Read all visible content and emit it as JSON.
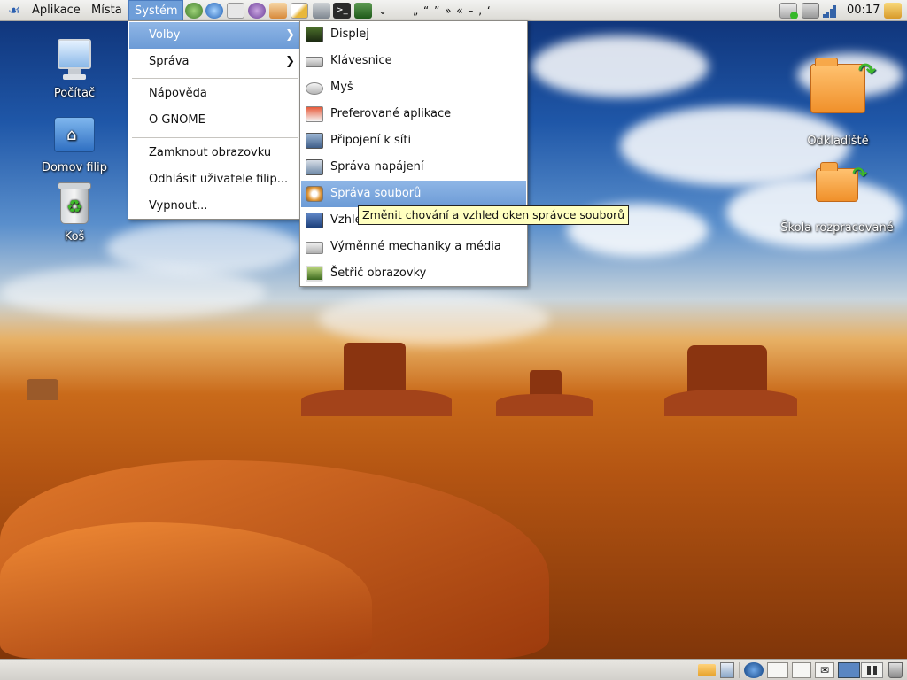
{
  "top_panel": {
    "menus": [
      "Aplikace",
      "Místa",
      "Systém"
    ],
    "punct_chars": "„  “  ”  »  «  –  ,  ‘",
    "clock": "00:17"
  },
  "desktop": {
    "left_icons": [
      {
        "label": "Počítač",
        "icon": "computer-icon"
      },
      {
        "label": "Domov filip",
        "icon": "home-folder-icon"
      },
      {
        "label": "Koš",
        "icon": "trash-icon"
      }
    ],
    "right_icons": [
      {
        "label": "Odkladiště",
        "icon": "folder-link-icon"
      },
      {
        "label": "Škola rozpracované",
        "icon": "folder-link-icon"
      }
    ]
  },
  "system_menu": {
    "items": [
      "Volby",
      "Správa",
      "Nápověda",
      "O GNOME",
      "Zamknout obrazovku",
      "Odhlásit uživatele filip...",
      "Vypnout..."
    ]
  },
  "volby_submenu": {
    "items": [
      {
        "label": "Displej",
        "icon": "display-icon"
      },
      {
        "label": "Klávesnice",
        "icon": "keyboard-icon"
      },
      {
        "label": "Myš",
        "icon": "mouse-icon"
      },
      {
        "label": "Preferované aplikace",
        "icon": "preferred-apps-icon"
      },
      {
        "label": "Připojení k síti",
        "icon": "network-icon"
      },
      {
        "label": "Správa napájení",
        "icon": "power-icon"
      },
      {
        "label": "Správa souborů",
        "icon": "file-manager-icon"
      },
      {
        "label": "Vzhled",
        "icon": "appearance-icon"
      },
      {
        "label": "Výměnné mechaniky a média",
        "icon": "removable-drive-icon"
      },
      {
        "label": "Šetřič obrazovky",
        "icon": "screensaver-icon"
      }
    ]
  },
  "tooltip": "Změnit chování a vzhled oken správce souborů",
  "colors": {
    "menu_highlight": "#6e9ed9",
    "tooltip_bg": "#ffffbf",
    "panel_bg": "#dcdad5"
  }
}
